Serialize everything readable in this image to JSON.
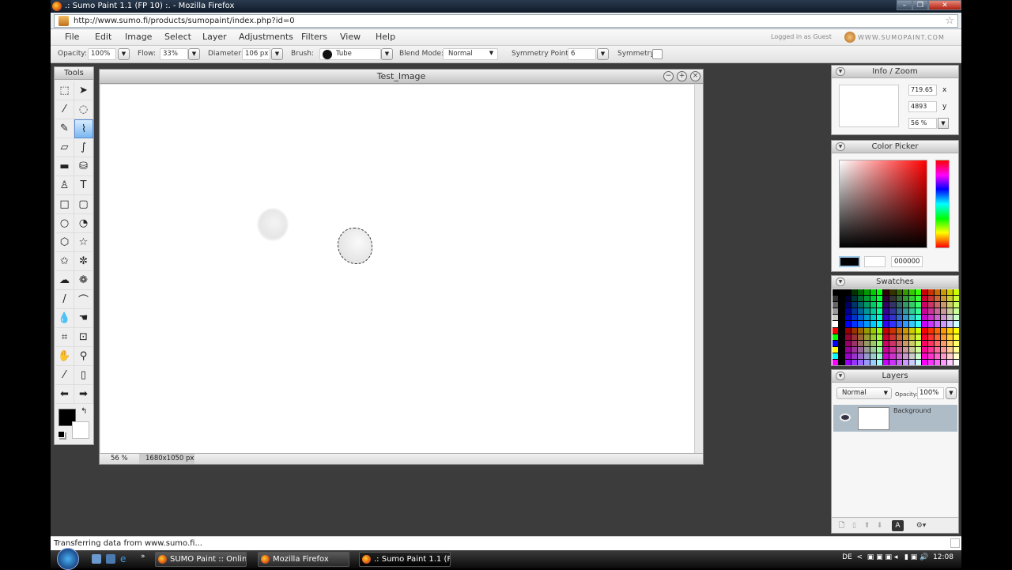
{
  "browser": {
    "window_title": ".: Sumo Paint 1.1 (FP 10) :. - Mozilla Firefox",
    "url": "http://www.sumo.fi/products/sumopaint/index.php?id=0",
    "window_buttons": [
      "minimize",
      "restore",
      "close"
    ]
  },
  "menubar": {
    "items": [
      "File",
      "Edit",
      "Image",
      "Select",
      "Layer",
      "Adjustments",
      "Filters",
      "View",
      "Help"
    ],
    "login_status": "Logged in as Guest",
    "site": "WWW.SUMOPAINT.COM"
  },
  "options": {
    "opacity_label": "Opacity:",
    "opacity": "100%",
    "flow_label": "Flow:",
    "flow": "33%",
    "diameter_label": "Diameter:",
    "diameter": "106 px",
    "brush_label": "Brush:",
    "brush": "Tube",
    "blend_label": "Blend Mode:",
    "blend": "Normal",
    "sympoints_label": "Symmetry Points:",
    "sympoints": "6",
    "symmetry_label": "Symmetry:",
    "symmetry_checked": false
  },
  "tools": {
    "title": "Tools",
    "items": [
      {
        "name": "marquee-tool",
        "glyph": "⬚"
      },
      {
        "name": "move-tool",
        "glyph": "➤"
      },
      {
        "name": "magic-wand-tool",
        "glyph": "⁄"
      },
      {
        "name": "lasso-tool",
        "glyph": "◌"
      },
      {
        "name": "pencil-tool",
        "glyph": "✎"
      },
      {
        "name": "brush-tool",
        "glyph": "⌇",
        "selected": true
      },
      {
        "name": "eraser-tool",
        "glyph": "▱"
      },
      {
        "name": "smudge-tool",
        "glyph": "∫"
      },
      {
        "name": "gradient-tool",
        "glyph": "▬"
      },
      {
        "name": "fill-tool",
        "glyph": "⛁"
      },
      {
        "name": "stamp-tool",
        "glyph": "♙"
      },
      {
        "name": "text-tool",
        "glyph": "T"
      },
      {
        "name": "rectangle-tool",
        "glyph": "□"
      },
      {
        "name": "rounded-rect-tool",
        "glyph": "▢"
      },
      {
        "name": "ellipse-tool",
        "glyph": "○"
      },
      {
        "name": "pie-tool",
        "glyph": "◔"
      },
      {
        "name": "hexagon-tool",
        "glyph": "⬡"
      },
      {
        "name": "star-tool",
        "glyph": "☆"
      },
      {
        "name": "flower-star-tool",
        "glyph": "✩"
      },
      {
        "name": "gear-shape-tool",
        "glyph": "✼"
      },
      {
        "name": "blob-shape-tool",
        "glyph": "☁"
      },
      {
        "name": "flower-tool",
        "glyph": "❁"
      },
      {
        "name": "line-tool",
        "glyph": "/"
      },
      {
        "name": "curve-tool",
        "glyph": "⌒"
      },
      {
        "name": "blur-tool",
        "glyph": "💧"
      },
      {
        "name": "dodge-tool",
        "glyph": "☚"
      },
      {
        "name": "crop-tool",
        "glyph": "⌗"
      },
      {
        "name": "transform-tool",
        "glyph": "⊡"
      },
      {
        "name": "hand-tool",
        "glyph": "✋"
      },
      {
        "name": "zoom-tool",
        "glyph": "⚲"
      },
      {
        "name": "eyedropper-tool",
        "glyph": "⁄"
      },
      {
        "name": "trash-tool",
        "glyph": "▯"
      },
      {
        "name": "undo-arrow",
        "glyph": "⬅"
      },
      {
        "name": "redo-arrow",
        "glyph": "➡"
      }
    ],
    "fg_color": "#000000",
    "bg_color": "#ffffff"
  },
  "document": {
    "title": "Test_Image",
    "zoom": "56 %",
    "size": "1680x1050 px"
  },
  "info": {
    "title": "Info / Zoom",
    "x": "719.65",
    "x_label": "x",
    "y": "4893",
    "y_label": "y",
    "zoom": "56 %"
  },
  "color_picker": {
    "title": "Color Picker",
    "hex": "000000",
    "hue_color": "#ff0000"
  },
  "swatches": {
    "title": "Swatches"
  },
  "layers": {
    "title": "Layers",
    "blend": "Normal",
    "opacity_label": "Opacity:",
    "opacity": "100%",
    "items": [
      {
        "name": "Background",
        "visible": true
      }
    ]
  },
  "status": {
    "text": "Transferring data from www.sumo.fi..."
  },
  "taskbar": {
    "tasks": [
      {
        "label": "SUMO Paint :: Onlin...",
        "active": false
      },
      {
        "label": "Mozilla Firefox",
        "active": false
      },
      {
        "label": ".: Sumo Paint 1.1 (F...",
        "active": true
      }
    ],
    "language": "DE",
    "clock": "12:08"
  }
}
